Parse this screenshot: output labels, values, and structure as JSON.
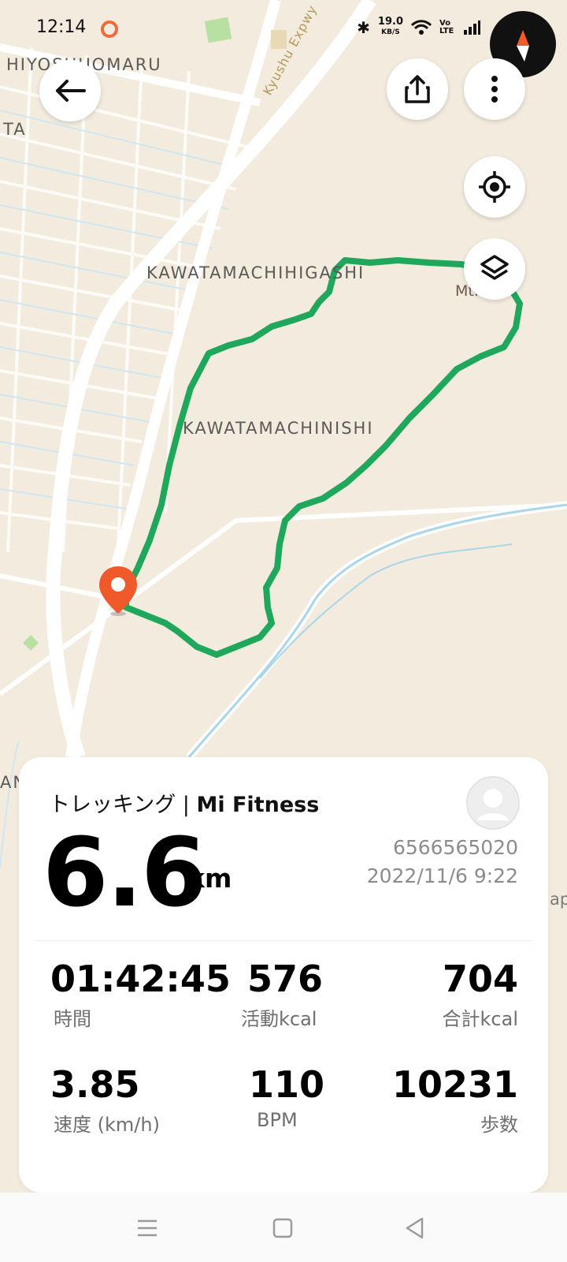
{
  "status_bar": {
    "time": "12:14",
    "net_speed_value": "19.0",
    "net_speed_unit": "KB/S",
    "volte": "Vo LTE"
  },
  "map": {
    "labels": {
      "hiyoshi": "HIYOSHUOMARU",
      "ta": "TA",
      "kyushu": "Kyushu Expwy",
      "higashi": "KAWATAMACHIHIGASHI",
      "nishi": "KAWATAMACHINISHI",
      "mt": "Mt.Ⅰ  o",
      "an": "AN",
      "ap": "ap"
    }
  },
  "card": {
    "title_activity": "トレッキング",
    "title_sep": " | ",
    "title_app": "Mi Fitness",
    "distance": "6.6",
    "distance_unit": "km",
    "user_id": "6566565020",
    "datetime": "2022/11/6 9:22",
    "stats": [
      {
        "value": "01:42:45",
        "label": "時間"
      },
      {
        "value": "576",
        "label": "活動kcal"
      },
      {
        "value": "704",
        "label": "合計kcal"
      },
      {
        "value": "3.85",
        "label": "速度 (km/h)"
      },
      {
        "value": "110",
        "label": "BPM"
      },
      {
        "value": "10231",
        "label": "歩数"
      }
    ]
  },
  "colors": {
    "route": "#1fa85b",
    "pin": "#f05a2a",
    "map_bg": "#f3ebde",
    "river": "#a9d6ea"
  }
}
